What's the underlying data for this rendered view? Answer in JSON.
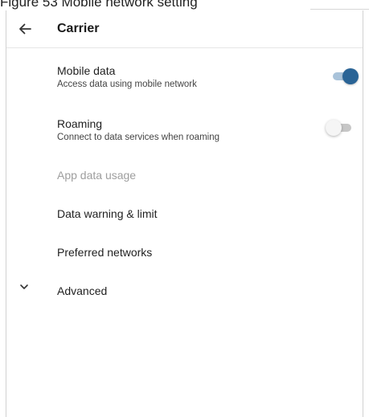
{
  "caption": "Figure 53 Mobile network setting",
  "header": {
    "back_icon": "arrow-back-icon",
    "title": "Carrier"
  },
  "settings": [
    {
      "title": "Mobile data",
      "subtitle": "Access data using mobile network",
      "toggle": "on"
    },
    {
      "title": "Roaming",
      "subtitle": "Connect to data services when roaming",
      "toggle": "off"
    },
    {
      "title": "App data usage",
      "enabled": false
    },
    {
      "title": "Data warning & limit"
    },
    {
      "title": "Preferred networks"
    },
    {
      "title": "Advanced",
      "icon": "chevron-down-icon"
    }
  ],
  "colors": {
    "toggle_on_thumb": "#2a6496",
    "toggle_on_track": "#a9c3da",
    "toggle_off_thumb": "#f5f5f5",
    "toggle_off_track": "#c7c7c7",
    "disabled_text": "#9e9e9e"
  }
}
